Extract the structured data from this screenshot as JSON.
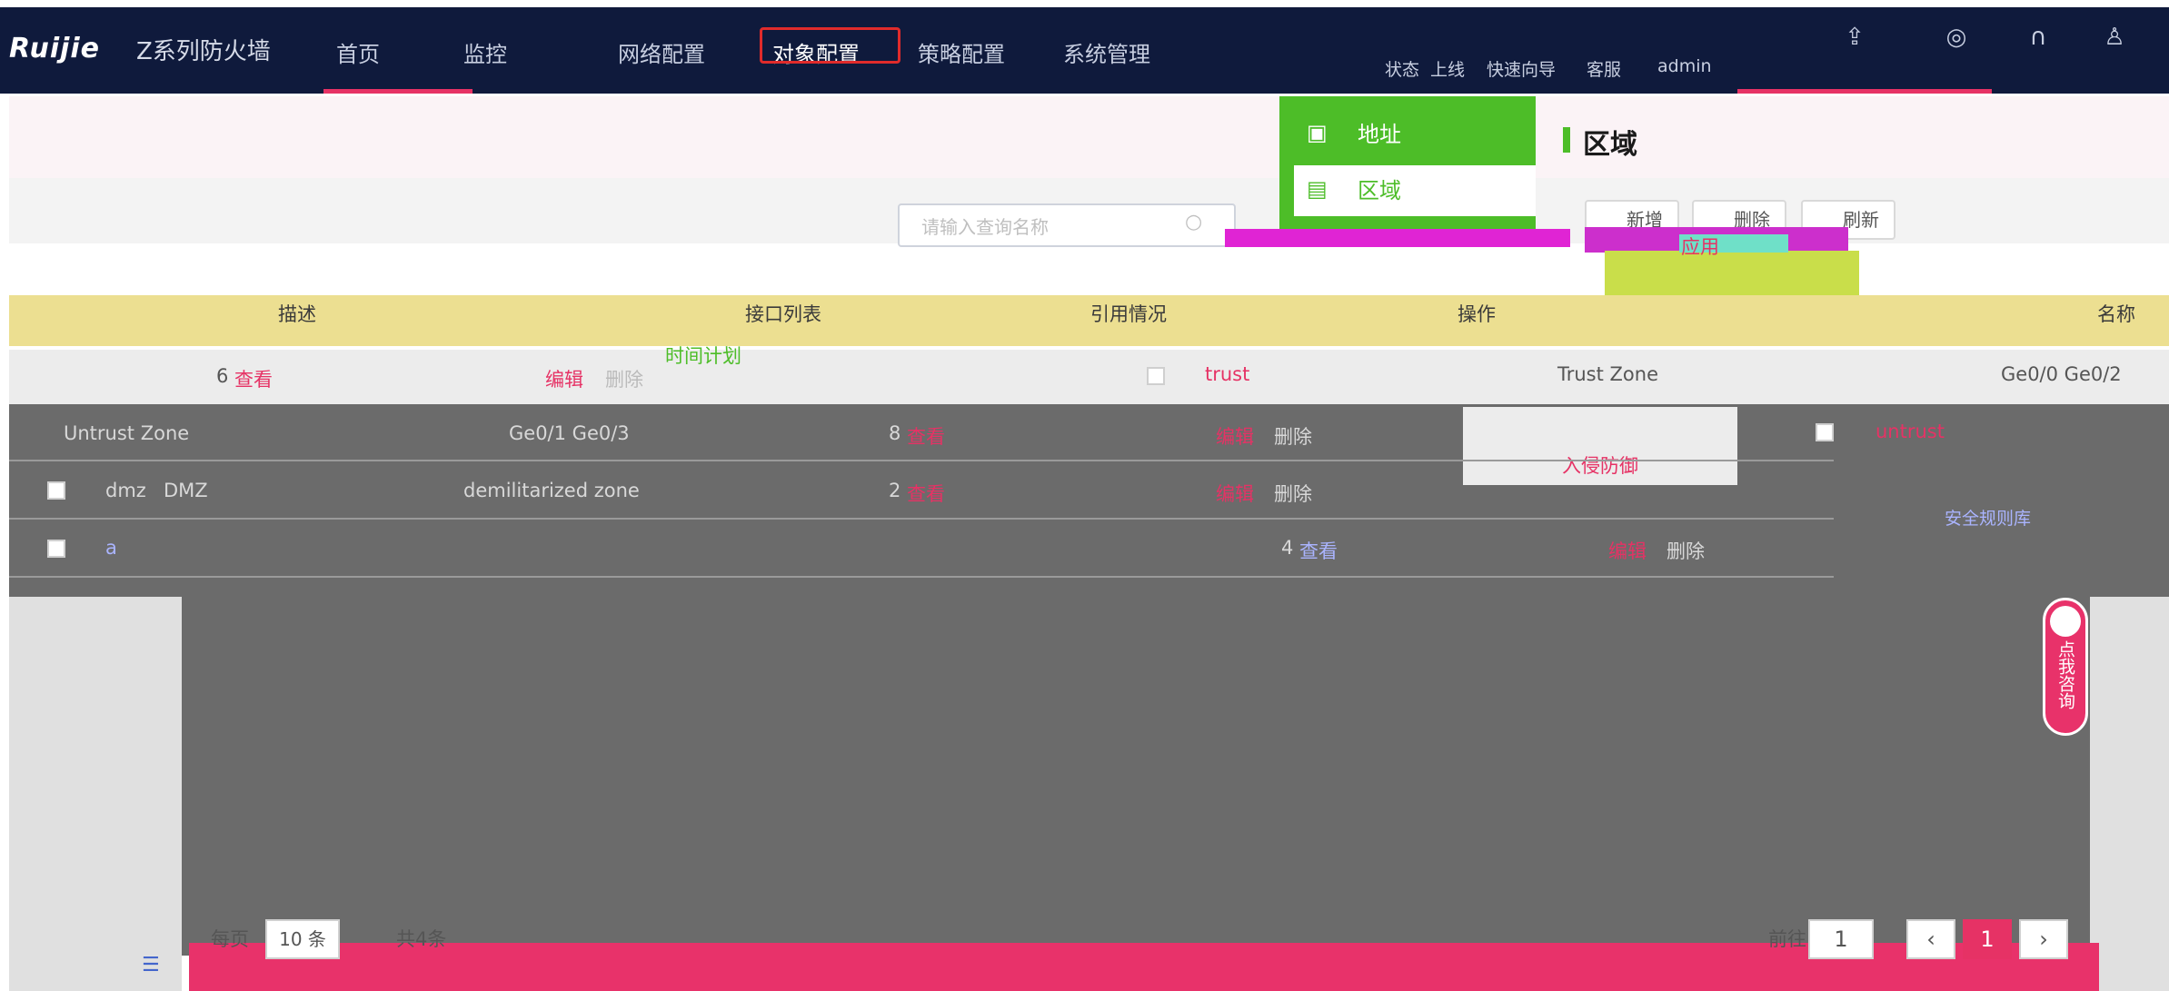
{
  "header": {
    "logo": "Ruijie",
    "product": "Z系列防火墙",
    "nav": [
      "首页",
      "监控",
      "网络配置",
      "对象配置",
      "策略配置",
      "系统管理"
    ],
    "links": [
      "状态",
      "上线",
      "快速向导",
      "客服",
      "admin"
    ],
    "icons": [
      "upload-icon",
      "compass-icon",
      "headset-icon",
      "user-icon"
    ]
  },
  "side_menu": {
    "items": [
      {
        "label": "地址",
        "icon": "ip-icon"
      },
      {
        "label": "区域",
        "icon": "zone-icon"
      }
    ],
    "extra": [
      "应用",
      "时间计划",
      "入侵防御",
      "安全规则库"
    ]
  },
  "page": {
    "title": "区域",
    "search_placeholder": "请输入查询名称",
    "toolbar": {
      "add": "新增",
      "delete": "删除",
      "refresh": "刷新"
    }
  },
  "table": {
    "headers": [
      "名称",
      "描述",
      "接口列表",
      "引用情况",
      "操作"
    ],
    "rows": [
      {
        "name": "trust",
        "desc": "Trust Zone",
        "interfaces": "Ge0/0 Ge0/2",
        "refs": "6",
        "view": "查看",
        "edit": "编辑",
        "delete": "删除"
      },
      {
        "name": "untrust",
        "desc": "Untrust Zone",
        "interfaces": "Ge0/1 Ge0/3",
        "refs": "8",
        "view": "查看",
        "edit": "编辑",
        "delete": "删除"
      },
      {
        "name": "dmz",
        "desc": "DMZ",
        "interfaces": "demilitarized zone",
        "refs": "2",
        "view": "查看",
        "edit": "编辑",
        "delete": "删除"
      },
      {
        "name": "a",
        "desc": "",
        "interfaces": "",
        "refs": "4",
        "view": "查看",
        "edit": "编辑",
        "delete": "删除"
      }
    ]
  },
  "pagination": {
    "page_size_label": "每页",
    "page_size": "10 条",
    "total_label": "共4条",
    "goto_label": "前往",
    "goto_value": "1",
    "current": "1"
  },
  "consult": "点我咨询",
  "colors": {
    "header_bg": "#0f1a3c",
    "accent": "#e63265",
    "menu_green": "#4dbd28",
    "table_head": "#ecdf91"
  }
}
